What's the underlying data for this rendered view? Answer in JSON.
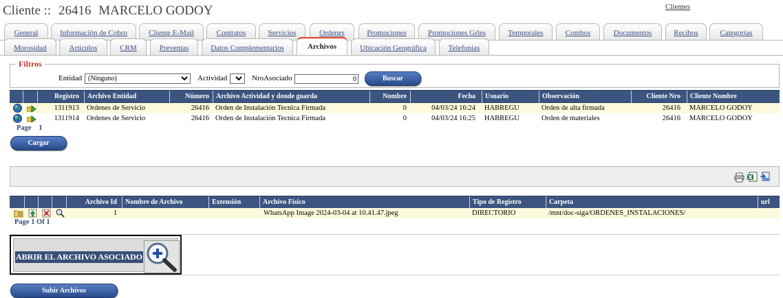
{
  "header": {
    "prefix": "Cliente ::",
    "client_id": "26416",
    "client_name": "MARCELO GODOY",
    "top_link": "Clientes"
  },
  "tabs_row1": [
    "General",
    "Información de Cobro",
    "Cliente E-Mail",
    "Contratos",
    "Servicios",
    "Ordenes",
    "Promociones",
    "Promociones Grles",
    "Temporales",
    "Combos",
    "Documentos",
    "Recibos",
    "Categorias"
  ],
  "tabs_row2": [
    "Morosidad",
    "Articulos",
    "CRM",
    "Preventas",
    "Datos Complementarios",
    "Archivos",
    "Ubicación Geográfica",
    "Telefonias"
  ],
  "active_tab": "Archivos",
  "filters": {
    "legend": "Filtros",
    "entidad_label": "Entidad",
    "entidad_value": "(Ninguno)",
    "actividad_label": "Actividad",
    "actividad_value": "",
    "nro_label": "NroAsociado",
    "nro_value": "0",
    "search_button": "Buscar"
  },
  "records_table": {
    "columns": [
      "",
      "",
      "Registro",
      "Archivo Entidad",
      "Número",
      "Archivo Actividad y donde guarda",
      "Nombre",
      "Fecha",
      "Usuario",
      "Observación",
      "Cliente Nro",
      "Cliente Nombre"
    ],
    "rows": [
      [
        "1311913",
        "Ordenes de Servicio",
        "26416",
        "Orden de Instalación Tecnica Firmada",
        "0",
        "04/03/24 16:24",
        "HABREGU",
        "Orden de alta firmada",
        "26416",
        "MARCELO GODOY"
      ],
      [
        "1311914",
        "Ordenes de Servicio",
        "26416",
        "Orden de Instalación Tecnica Firmada",
        "0",
        "04/03/24 16:25",
        "HABREGU",
        "Orden de materiales",
        "26416",
        "MARCELO GODOY"
      ]
    ],
    "pager_label": "Page",
    "pager_value": "1",
    "load_button": "Cargar"
  },
  "toolbar_icons": [
    "print-icon",
    "excel-export-icon",
    "export-icon"
  ],
  "files_table": {
    "columns": [
      "",
      "",
      "",
      "",
      "Archivo Id",
      "Nombre de Archivo",
      "Extensión",
      "Archivo Fisico",
      "Tipo de Registro",
      "Carpeta",
      "url"
    ],
    "rows": [
      [
        "1",
        "",
        "",
        "WhatsApp Image 2024-03-04 at 10.41.47.jpeg",
        "DIRECTORIO",
        "/mnt/doc-siga/ORDENES_INSTALACIONES/",
        ""
      ]
    ],
    "pager": "Page 1 Of 1"
  },
  "open_file": {
    "label": "ABRIR EL ARCHIVO ASOCIADO"
  },
  "upload_button": "Subir Archivos",
  "colors": {
    "header_bg": "#3b5580",
    "row_highlight": "#fdf9dc",
    "legend_red": "#c0392b",
    "active_tab_accent": "#d9401e",
    "button_blue": "#274a8c"
  }
}
